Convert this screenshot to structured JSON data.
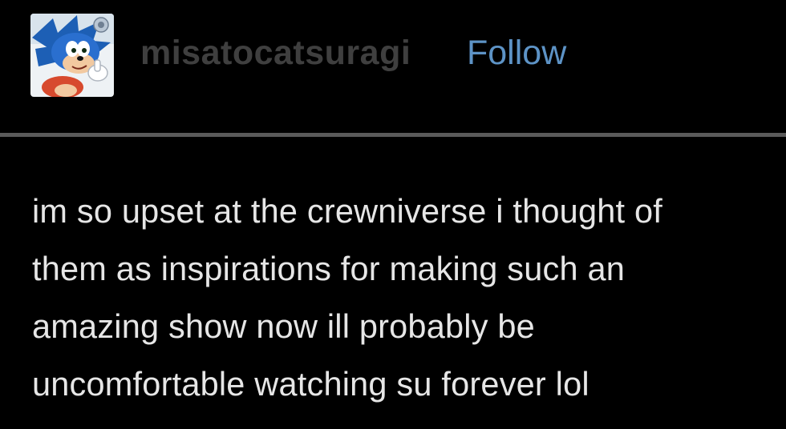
{
  "header": {
    "avatar_icon": "sonic-hedgehog-avatar-icon",
    "username": "misatocatsuragi",
    "follow_label": "Follow"
  },
  "post": {
    "lines": [
      "im so upset at the crewniverse i thought of",
      "them as inspirations for making such an",
      "amazing show now ill probably be",
      "uncomfortable watching su forever lol"
    ]
  },
  "colors": {
    "background": "#000000",
    "username": "#3f3f3f",
    "follow_link": "#5d93c6",
    "body_text": "#e6e6e6",
    "divider": "#5a5a5a"
  }
}
